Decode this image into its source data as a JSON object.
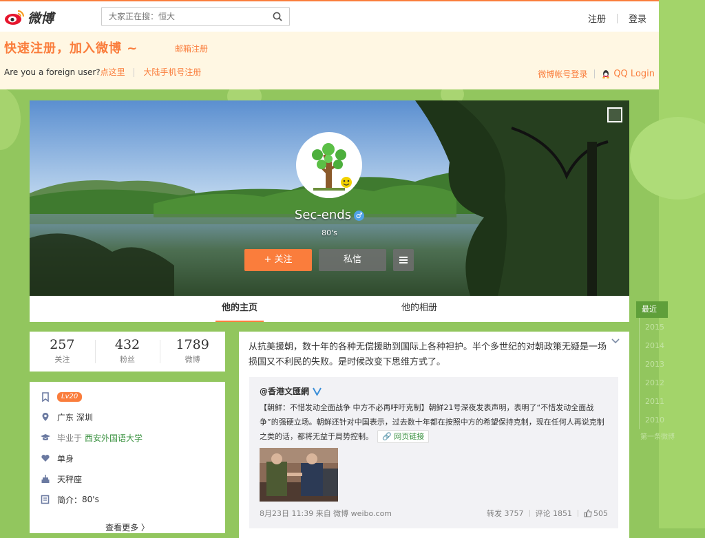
{
  "app": {
    "brand": "微博"
  },
  "search": {
    "placeholder": "大家正在搜：恒大"
  },
  "topnav": {
    "register": "注册",
    "login": "登录"
  },
  "banner": {
    "headline": "快速注册，加入微博 ~",
    "email_register": "邮箱注册",
    "foreign_prefix": "Are you a foreign user?",
    "foreign_link": "点这里",
    "phone_register": "大陆手机号注册",
    "weibo_login": "微博帐号登录",
    "qq_login": "QQ Login"
  },
  "profile": {
    "username": "Sec-ends",
    "gender_symbol": "♂",
    "tagline": "80's",
    "follow_button": "关注",
    "follow_plus": "+",
    "message_button": "私信"
  },
  "tabs": [
    {
      "label": "他的主页",
      "active": true
    },
    {
      "label": "他的相册",
      "active": false
    }
  ],
  "stats": [
    {
      "value": "257",
      "label": "关注"
    },
    {
      "value": "432",
      "label": "粉丝"
    },
    {
      "value": "1789",
      "label": "微博"
    }
  ],
  "info": {
    "level": "Lv20",
    "location": "广东 深圳",
    "edu_prefix": "毕业于",
    "school": "西安外国语大学",
    "relationship": "单身",
    "zodiac": "天秤座",
    "bio_label": "简介：",
    "bio": "80's",
    "more": "查看更多 〉"
  },
  "feed": {
    "text": "从抗美援朝，数十年的各种无偿援助到国际上各种袒护。半个多世纪的对朝政策无疑是一场损国又不利民的失败。是时候改变下思维方式了。",
    "repost": {
      "author": "@香港文匯網",
      "text": "【朝鲜：不惜发动全面战争 中方不必再呼吁克制】朝鲜21号深夜发表声明，表明了“不惜发动全面战争”的强硬立场。朝鲜还针对中国表示，过去数十年都在按照中方的希望保持克制，现在任何人再说克制之类的话，都将无益于局势控制。",
      "link_label": "网页链接",
      "meta": "8月23日 11:39 来自 微博 weibo.com",
      "reposts": "转发 3757",
      "comments": "评论 1851",
      "likes": "505"
    }
  },
  "timeline": {
    "active": "最近",
    "years": [
      "2015",
      "2014",
      "2013",
      "2012",
      "2011",
      "2010"
    ],
    "first": "第一条微博"
  },
  "colors": {
    "accent": "#fa7d3c",
    "background": "#92c65e",
    "link_green": "#3b9241"
  }
}
